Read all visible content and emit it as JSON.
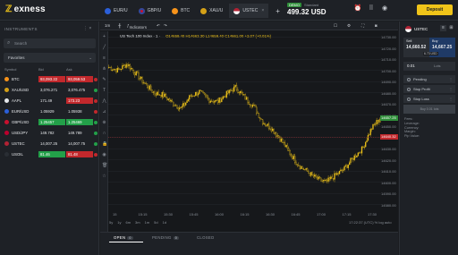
{
  "brand": {
    "logo_text": "exness"
  },
  "tabs": [
    {
      "label": "EUR/U",
      "flag": "eu"
    },
    {
      "label": "GBP/U",
      "flag": "gb"
    },
    {
      "label": "BTC",
      "flag": "btc"
    },
    {
      "label": "XAU/U",
      "flag": "xau"
    },
    {
      "label": "USTEC",
      "flag": "us",
      "active": true
    }
  ],
  "account": {
    "badge": "DEMO",
    "type": "Standard",
    "balance": "499.32 USD"
  },
  "header": {
    "deposit_label": "Deposit"
  },
  "instruments": {
    "title": "INSTRUMENTS",
    "search_placeholder": "Search",
    "filter": "Favorites",
    "columns": {
      "symbol": "Symbol",
      "bid": "Bid",
      "ask": "Ask"
    },
    "rows": [
      {
        "symbol": "BTC",
        "bid": "93,093.22",
        "ask": "93,059.53",
        "bid_color": "red",
        "ask_color": "red",
        "icon": "#f7931a",
        "chg": "#c2282c"
      },
      {
        "symbol": "XAU/USD",
        "bid": "3,076.271",
        "ask": "3,076.475",
        "bid_color": "",
        "ask_color": "",
        "icon": "#d4a017",
        "chg": "#23a049"
      },
      {
        "symbol": "AAPL",
        "bid": "171.49",
        "ask": "173.23",
        "bid_color": "",
        "ask_color": "red",
        "icon": "#e6e8eb",
        "chg": "#c2282c"
      },
      {
        "symbol": "EUR/USD",
        "bid": "1.05929",
        "ask": "1.05938",
        "bid_color": "",
        "ask_color": "",
        "icon": "#2b5fd9",
        "chg": "#c2282c"
      },
      {
        "symbol": "GBP/USD",
        "bid": "1.25457",
        "ask": "1.25469",
        "bid_color": "green",
        "ask_color": "green",
        "icon": "#c8102e",
        "chg": "#23a049"
      },
      {
        "symbol": "USD/JPY",
        "bid": "149.782",
        "ask": "149.789",
        "bid_color": "",
        "ask_color": "",
        "icon": "#bc002d",
        "chg": "#23a049"
      },
      {
        "symbol": "USTEC",
        "bid": "14,007.25",
        "ask": "14,007.75",
        "bid_color": "",
        "ask_color": "",
        "icon": "#b22234",
        "chg": "#23a049"
      },
      {
        "symbol": "USOIL",
        "bid": "81.46",
        "ask": "81.48",
        "bid_color": "green",
        "ask_color": "red",
        "icon": "#2a2e34",
        "chg": "#c2282c"
      }
    ]
  },
  "chart_toolbar": {
    "timeframe": "1m",
    "indicators": "Indicators"
  },
  "chart_info": {
    "title": "US Tech 100 Index · 1 ·",
    "ohlc": "O14659.40 H14663.30 L14659.40 C14661.00 +2.07 (+0.01%)"
  },
  "chart_data": {
    "type": "candlestick",
    "x_ticks": [
      "15",
      "15:15",
      "15:30",
      "15:45",
      "16:00",
      "16:15",
      "16:30",
      "16:45",
      "17:00",
      "17:15",
      "17:30"
    ],
    "y_ticks": [
      "14730.00",
      "14720.00",
      "14710.00",
      "14700.00",
      "14690.00",
      "14680.00",
      "14670.00",
      "14660.00",
      "14650.00",
      "14640.00",
      "14630.00",
      "14620.00",
      "14610.00",
      "14600.00",
      "14590.00",
      "14580.00"
    ],
    "ylim": [
      14575,
      14735
    ],
    "current_price": "14657.25",
    "reference_price": "14640.32",
    "close": [
      14703,
      14700,
      14706,
      14697,
      14688,
      14680,
      14678,
      14671,
      14666,
      14677,
      14681,
      14674,
      14672,
      14679,
      14685,
      14676,
      14668,
      14654,
      14648,
      14638,
      14626,
      14615,
      14609,
      14603,
      14600,
      14606,
      14612,
      14622,
      14630,
      14648,
      14658
    ]
  },
  "range_buttons": [
    "5y",
    "1y",
    "6m",
    "3m",
    "1m",
    "5d",
    "1d"
  ],
  "time_readout": "17:22:37 (UTC)   %   log   auto",
  "bottom_tabs": [
    {
      "label": "OPEN",
      "count": "0"
    },
    {
      "label": "PENDING",
      "count": "0"
    },
    {
      "label": "CLOSED",
      "count": ""
    }
  ],
  "order_panel": {
    "symbol": "USTEC",
    "sell_label": "Sell",
    "sell_price": "14,660.52",
    "buy_label": "Buy",
    "buy_price": "14,667.25",
    "spread": "6.73 USD",
    "volume": "0.01",
    "volume_unit": "Lots",
    "options": [
      "Pending",
      "Stop Profit",
      "Stop Loss"
    ],
    "place_button": "Buy 0.01 lots",
    "details": [
      "Fees:",
      "Leverage:",
      "Currency:",
      "Margin:",
      "Pip Value:"
    ]
  }
}
